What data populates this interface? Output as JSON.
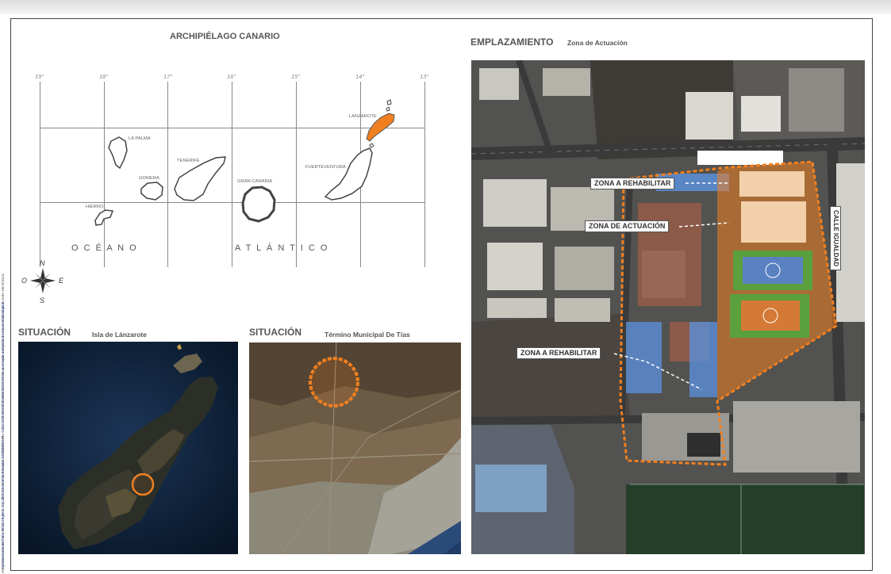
{
  "sidebar_note": {
    "line1": "Ayuntamiento de Tías - Nº de registro del Libro General de Entrada: 2020/00001 R - CSV: 1525276439410051924 Este es una copia auténtica de documento original",
    "line2": "electrónico conforme al artículo 27 de la Ley 39/2015 del Procedimiento Administrativo Común de las Administraciones Públicas. Puede comprobar su autenticidad en la sede electrónica"
  },
  "canarias_map": {
    "title": "ARCHIPIÉLAGO CANARIO",
    "longitudes": [
      "19°",
      "18°",
      "17°",
      "16°",
      "15°",
      "14°",
      "13°"
    ],
    "islands": {
      "lanzarote": "LANZAROTE",
      "fuerteventura": "FUERTEVENTURA",
      "gran_canaria": "GRAN CANARIA",
      "tenerife": "TENERIFE",
      "la_palma": "LA PALMA",
      "gomera": "GOMERA",
      "hierro": "HIERRO"
    },
    "ocean_word1": "O C É A N O",
    "ocean_word2": "A T L Á N T I C O",
    "compass": {
      "n": "N",
      "s": "S",
      "e": "E",
      "o": "O"
    },
    "highlight_color": "#f07f20"
  },
  "situacion_isla": {
    "title": "SITUACIÓN",
    "subtitle": "Isla de Lánzarote"
  },
  "situacion_municipio": {
    "title": "SITUACIÓN",
    "subtitle": "Término Municipal De Tías"
  },
  "emplazamiento": {
    "title": "EMPLAZAMIENTO",
    "subtitle": "Zona de Actuación",
    "label_rehab_top": "ZONA A REHABILITAR",
    "label_actuacion": "ZONA DE ACTUACIÓN",
    "label_rehab_bottom": "ZONA A REHABILITAR",
    "street": "CALLE IGUALDAD",
    "actuacion_color": "#f07f20",
    "rehab_color": "#5b8fd8"
  }
}
